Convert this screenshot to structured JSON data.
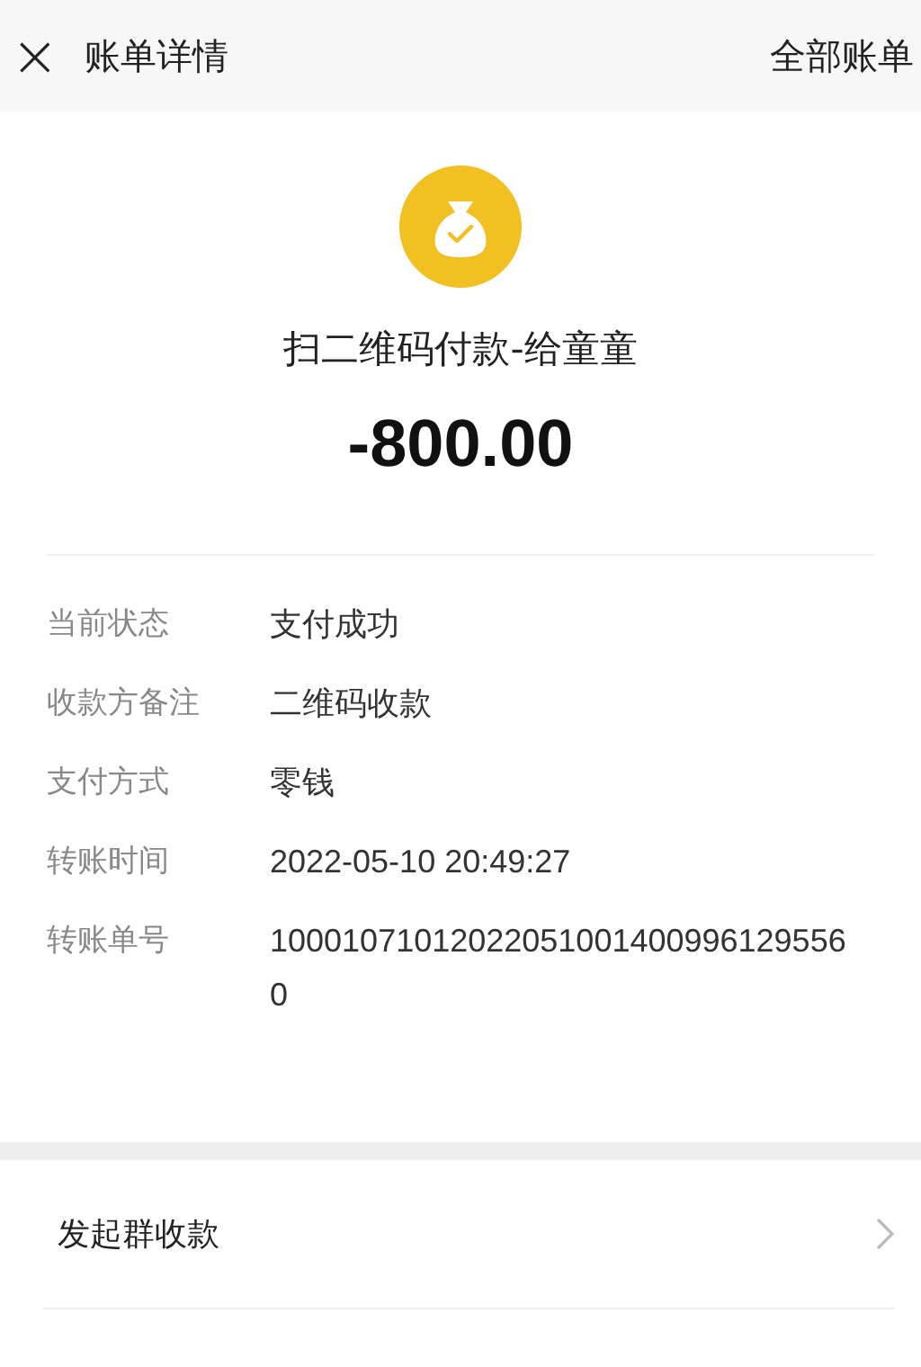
{
  "header": {
    "close": "×",
    "title": "账单详情",
    "action": "全部账单"
  },
  "summary": {
    "title": "扫二维码付款-给童童",
    "amount": "-800.00"
  },
  "details": [
    {
      "label": "当前状态",
      "value": "支付成功"
    },
    {
      "label": "收款方备注",
      "value": "二维码收款"
    },
    {
      "label": "支付方式",
      "value": "零钱"
    },
    {
      "label": "转账时间",
      "value": "2022-05-10 20:49:27"
    },
    {
      "label": "转账单号",
      "value": "100010710120220510014009961295560"
    }
  ],
  "actions": [
    {
      "label": "发起群收款"
    }
  ]
}
